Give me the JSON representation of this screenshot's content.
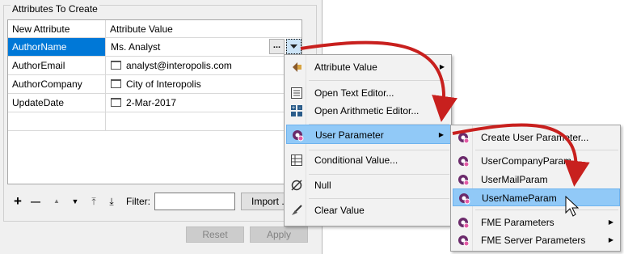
{
  "dialog": {
    "group_title": "Attributes To Create",
    "columns": [
      "New Attribute",
      "Attribute Value"
    ],
    "rows": [
      {
        "name": "AuthorName",
        "value": "Ms. Analyst"
      },
      {
        "name": "AuthorEmail",
        "value": "analyst@interopolis.com"
      },
      {
        "name": "AuthorCompany",
        "value": "City of Interopolis"
      },
      {
        "name": "UpdateDate",
        "value": "2-Mar-2017"
      }
    ],
    "ellipsis_label": "...",
    "toolbar": {
      "add": "+",
      "remove": "—",
      "up": "▲",
      "down": "▼",
      "top": "⤒",
      "bottom": "⤓",
      "filter_label": "Filter:",
      "filter_value": "",
      "import_label": "Import ..."
    },
    "reset_label": "Reset",
    "apply_label": "Apply"
  },
  "context_menu": {
    "items": [
      {
        "label": "Attribute Value",
        "icon": "attribute-value-icon",
        "submenu": true
      },
      {
        "label": "Open Text Editor...",
        "icon": "text-editor-icon"
      },
      {
        "label": "Open Arithmetic Editor...",
        "icon": "arithmetic-editor-icon"
      },
      {
        "label": "User Parameter",
        "icon": "user-parameter-icon",
        "submenu": true
      },
      {
        "label": "Conditional Value...",
        "icon": "conditional-value-icon"
      },
      {
        "label": "Null",
        "icon": "null-icon"
      },
      {
        "label": "Clear Value",
        "icon": "clear-value-icon"
      }
    ],
    "highlighted": "User Parameter"
  },
  "submenu": {
    "items": [
      {
        "label": "Create User Parameter...",
        "icon": "create-parameter-icon"
      },
      {
        "label": "UserCompanyParam",
        "icon": "parameter-icon"
      },
      {
        "label": "UserMailParam",
        "icon": "parameter-icon"
      },
      {
        "label": "UserNameParam",
        "icon": "parameter-icon"
      },
      {
        "label": "FME Parameters",
        "icon": "parameter-icon",
        "submenu": true
      },
      {
        "label": "FME Server Parameters",
        "icon": "parameter-icon",
        "submenu": true
      }
    ],
    "highlighted": "UserNameParam"
  },
  "colors": {
    "selection": "#0078d7",
    "menu_highlight": "#91c9f7",
    "arrow": "#c8201e"
  },
  "submenu_arrow_glyph": "▶"
}
